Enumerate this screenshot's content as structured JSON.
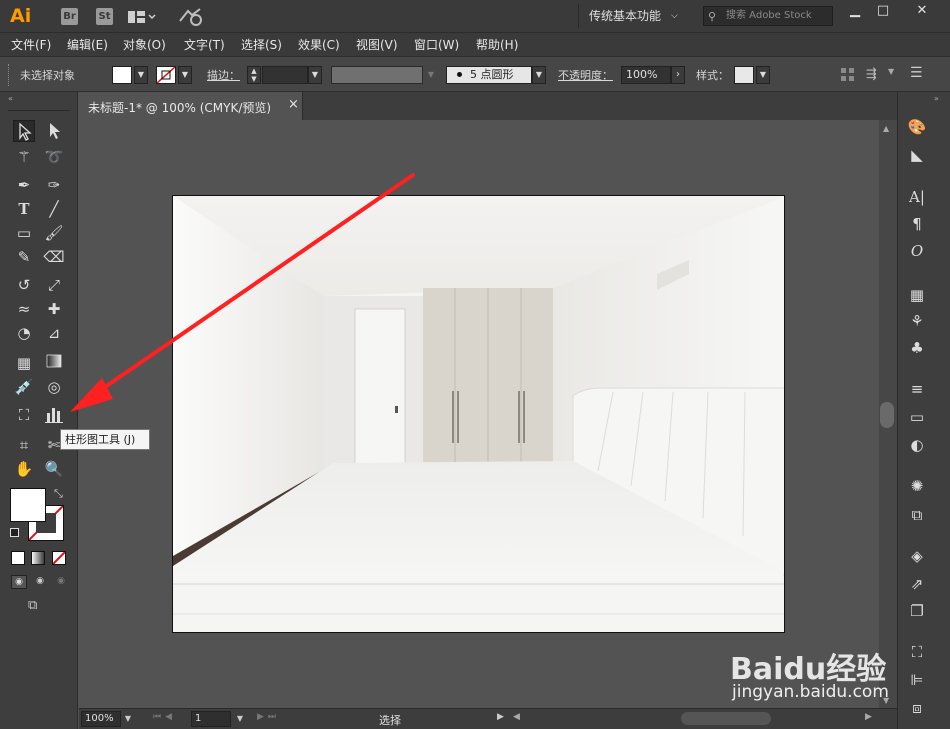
{
  "app": {
    "logo": "Ai",
    "badges": [
      "Br",
      "St"
    ],
    "workspace": "传统基本功能",
    "search_placeholder": "搜索 Adobe Stock"
  },
  "menu": [
    "文件(F)",
    "编辑(E)",
    "对象(O)",
    "文字(T)",
    "选择(S)",
    "效果(C)",
    "视图(V)",
    "窗口(W)",
    "帮助(H)"
  ],
  "control": {
    "selection": "未选择对象",
    "stroke_label": "描边：",
    "brush": "5 点圆形",
    "opacity_label": "不透明度：",
    "opacity_value": "100%",
    "style_label": "样式："
  },
  "document": {
    "tab_title": "未标题-1* @ 100% (CMYK/预览)",
    "close": "×"
  },
  "tooltip": "柱形图工具 (J)",
  "status": {
    "zoom": "100%",
    "page": "1",
    "mode": "选择"
  },
  "watermark": {
    "brand": "Baidu经验",
    "url": "jingyan.baidu.com"
  },
  "colors": {
    "arrow": "#ff2020",
    "ai_orange": "#ff9a00"
  }
}
